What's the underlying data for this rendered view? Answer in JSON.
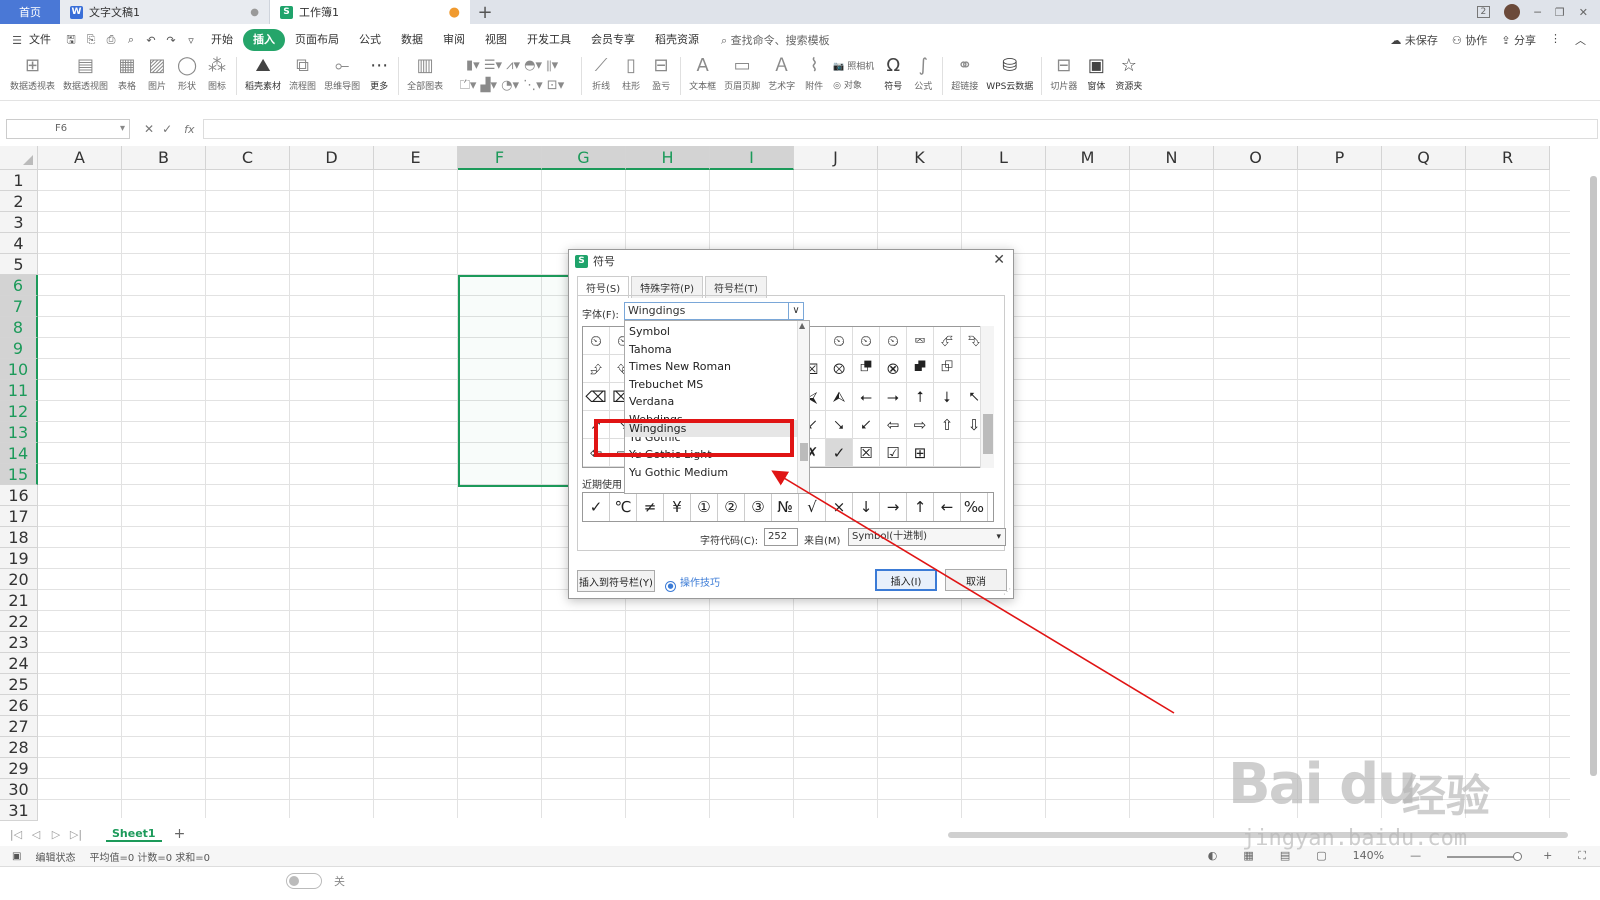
{
  "titlebar": {
    "tabs": [
      {
        "label": "首页"
      },
      {
        "label": "文字文稿1",
        "icon": "W"
      },
      {
        "label": "工作簿1",
        "icon": "S"
      }
    ],
    "new_tab": "+",
    "badge": "2"
  },
  "menubar": {
    "file": "文件",
    "items": [
      "开始",
      "插入",
      "页面布局",
      "公式",
      "数据",
      "审阅",
      "视图",
      "开发工具",
      "会员专享",
      "稻壳资源"
    ],
    "active": "插入",
    "search_placeholder": "查找命令、搜索模板",
    "right": [
      "未保存",
      "协作",
      "分享"
    ]
  },
  "ribbon": {
    "buttons": [
      "数据透视表",
      "数据透视图",
      "表格",
      "图片",
      "形状",
      "图标",
      "稻壳素材",
      "流程图",
      "思维导图",
      "更多",
      "全部图表",
      "折线",
      "柱形",
      "盈亏",
      "文本框",
      "页眉页脚",
      "艺术字",
      "附件",
      "照相机",
      "对象",
      "符号",
      "公式",
      "超链接",
      "WPS云数据",
      "切片器",
      "窗体",
      "资源夹"
    ]
  },
  "formulabar": {
    "cell_ref": "F6",
    "fx": "fx"
  },
  "grid": {
    "columns": [
      "A",
      "B",
      "C",
      "D",
      "E",
      "F",
      "G",
      "H",
      "I",
      "J",
      "K",
      "L",
      "M",
      "N",
      "O",
      "P",
      "Q",
      "R"
    ],
    "rows": [
      "1",
      "2",
      "3",
      "4",
      "5",
      "6",
      "7",
      "8",
      "9",
      "10",
      "11",
      "12",
      "13",
      "14",
      "15",
      "16",
      "17",
      "18",
      "19",
      "20",
      "21",
      "22",
      "23",
      "24",
      "25",
      "26",
      "27",
      "28",
      "29",
      "30",
      "31"
    ],
    "selected_columns": [
      "F",
      "G",
      "H",
      "I"
    ],
    "selected_rows": [
      "6",
      "7",
      "8",
      "9",
      "10",
      "11",
      "12",
      "13",
      "14",
      "15"
    ]
  },
  "sheets": {
    "active": "Sheet1",
    "add": "+"
  },
  "statusbar": {
    "mode": "编辑状态",
    "stats": "平均值=0  计数=0  求和=0",
    "zoom": "140%"
  },
  "bottom": {
    "toggle_label": "关"
  },
  "dialog": {
    "title": "符号",
    "tabs": [
      "符号(S)",
      "特殊字符(P)",
      "符号栏(T)"
    ],
    "font_label": "字体(F):",
    "font_value": "Wingdings",
    "font_options": [
      "Symbol",
      "Tahoma",
      "Times New Roman",
      "Trebuchet MS",
      "Verdana",
      "Webdings",
      "Wingdings",
      "Yu Gothic",
      "Yu Gothic Light",
      "Yu Gothic Medium"
    ],
    "font_selected": "Wingdings",
    "symbols": [
      [
        "⏲",
        "⏲",
        "",
        "",
        "",
        "",
        "",
        "",
        "",
        "⏲",
        "⏲",
        "⏲",
        "⮹",
        "⮶",
        "⮷"
      ],
      [
        "⮵",
        "⮴",
        "",
        "",
        "",
        "",
        "",
        "",
        "⮽",
        "⮾",
        "⮻",
        "⮿",
        "⮼",
        "⮺",
        ""
      ],
      [
        "⌫",
        "⌦",
        "",
        "",
        "",
        "",
        "",
        "",
        "⮘",
        "⮙",
        "⭠",
        "⭢",
        "⭡",
        "⭣",
        "⭦"
      ],
      [
        "⭧",
        "⭨",
        "",
        "",
        "",
        "",
        "",
        "",
        "⭩",
        "⭨",
        "⭩",
        "⇦",
        "⇨",
        "⇧",
        "⇩"
      ],
      [
        "⇦",
        "⇨",
        "",
        "",
        "",
        "",
        "",
        "",
        "✗",
        "✓",
        "☒",
        "☑",
        "⊞",
        "",
        ""
      ]
    ],
    "selected_symbol": "✓",
    "recent_label": "近期使用",
    "recent": [
      "✓",
      "℃",
      "≠",
      "¥",
      "①",
      "②",
      "③",
      "№",
      "√",
      "×",
      "↓",
      "→",
      "↑",
      "←",
      "‰"
    ],
    "code_label": "字符代码(C):",
    "code_value": "252",
    "from_label": "来自(M)",
    "from_value": "Symbol(十进制)",
    "insert_to_bar": "插入到符号栏(Y)",
    "tips": "操作技巧",
    "insert": "插入(I)",
    "cancel": "取消"
  },
  "watermark": {
    "logo": "Bai du",
    "cn": "经验",
    "url": "jingyan.baidu.com"
  },
  "colors": {
    "accent": "#1c9a5a",
    "annotation": "#e01414",
    "home_tab": "#4a78d6"
  }
}
